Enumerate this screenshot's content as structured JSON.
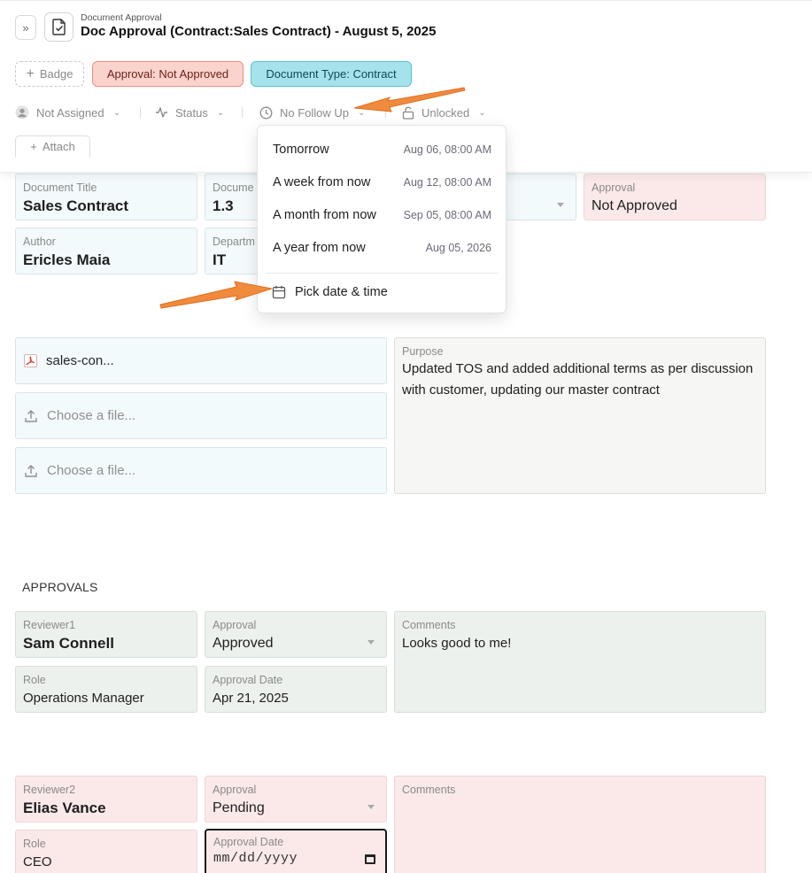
{
  "header": {
    "breadcrumb": "Document Approval",
    "title": "Doc Approval (Contract:Sales Contract) - August 5, 2025",
    "badge_add_label": "Badge",
    "badges": {
      "approval": "Approval: Not Approved",
      "doc_type": "Document Type: Contract"
    },
    "meta": {
      "assignee": "Not Assigned",
      "status": "Status",
      "follow_up": "No Follow Up",
      "lock": "Unlocked"
    },
    "attach_label": "Attach"
  },
  "followup_menu": {
    "options": [
      {
        "label": "Tomorrow",
        "when": "Aug 06, 08:00 AM"
      },
      {
        "label": "A week from now",
        "when": "Aug 12, 08:00 AM"
      },
      {
        "label": "A month from now",
        "when": "Sep 05, 08:00 AM"
      },
      {
        "label": "A year from now",
        "when": "Aug 05, 2026"
      }
    ],
    "pick_label": "Pick date & time"
  },
  "document": {
    "title_label": "Document Title",
    "title_value": "Sales Contract",
    "version_label": "Docume",
    "version_value": "1.3",
    "approval_label": "Approval",
    "approval_value": "Not Approved",
    "author_label": "Author",
    "author_value": "Ericles Maia",
    "dept_label": "Departm",
    "dept_value": "IT"
  },
  "files": {
    "attached": "sales-con...",
    "choose_1": "Choose a file...",
    "choose_2": "Choose a file..."
  },
  "purpose": {
    "label": "Purpose",
    "text": "Updated TOS and added additional terms as per discussion with customer, updating our master contract"
  },
  "approvals": {
    "section_title": "APPROVALS",
    "reviewer1": {
      "reviewer_label": "Reviewer1",
      "reviewer_name": "Sam Connell",
      "approval_label": "Approval",
      "approval_value": "Approved",
      "comments_label": "Comments",
      "comments_value": "Looks good to me!",
      "role_label": "Role",
      "role_value": "Operations Manager",
      "date_label": "Approval Date",
      "date_value": "Apr 21, 2025"
    },
    "reviewer2": {
      "reviewer_label": "Reviewer2",
      "reviewer_name": "Elias Vance",
      "approval_label": "Approval",
      "approval_value": "Pending",
      "comments_label": "Comments",
      "role_label": "Role",
      "role_value": "CEO",
      "date_label": "Approval Date",
      "date_placeholder": "mm/dd/yyyy"
    }
  },
  "colors": {
    "annotation_arrow": "#f08a3c",
    "approval_badge_bg": "#fbd3cd",
    "doctype_badge_bg": "#a6e2eb"
  }
}
